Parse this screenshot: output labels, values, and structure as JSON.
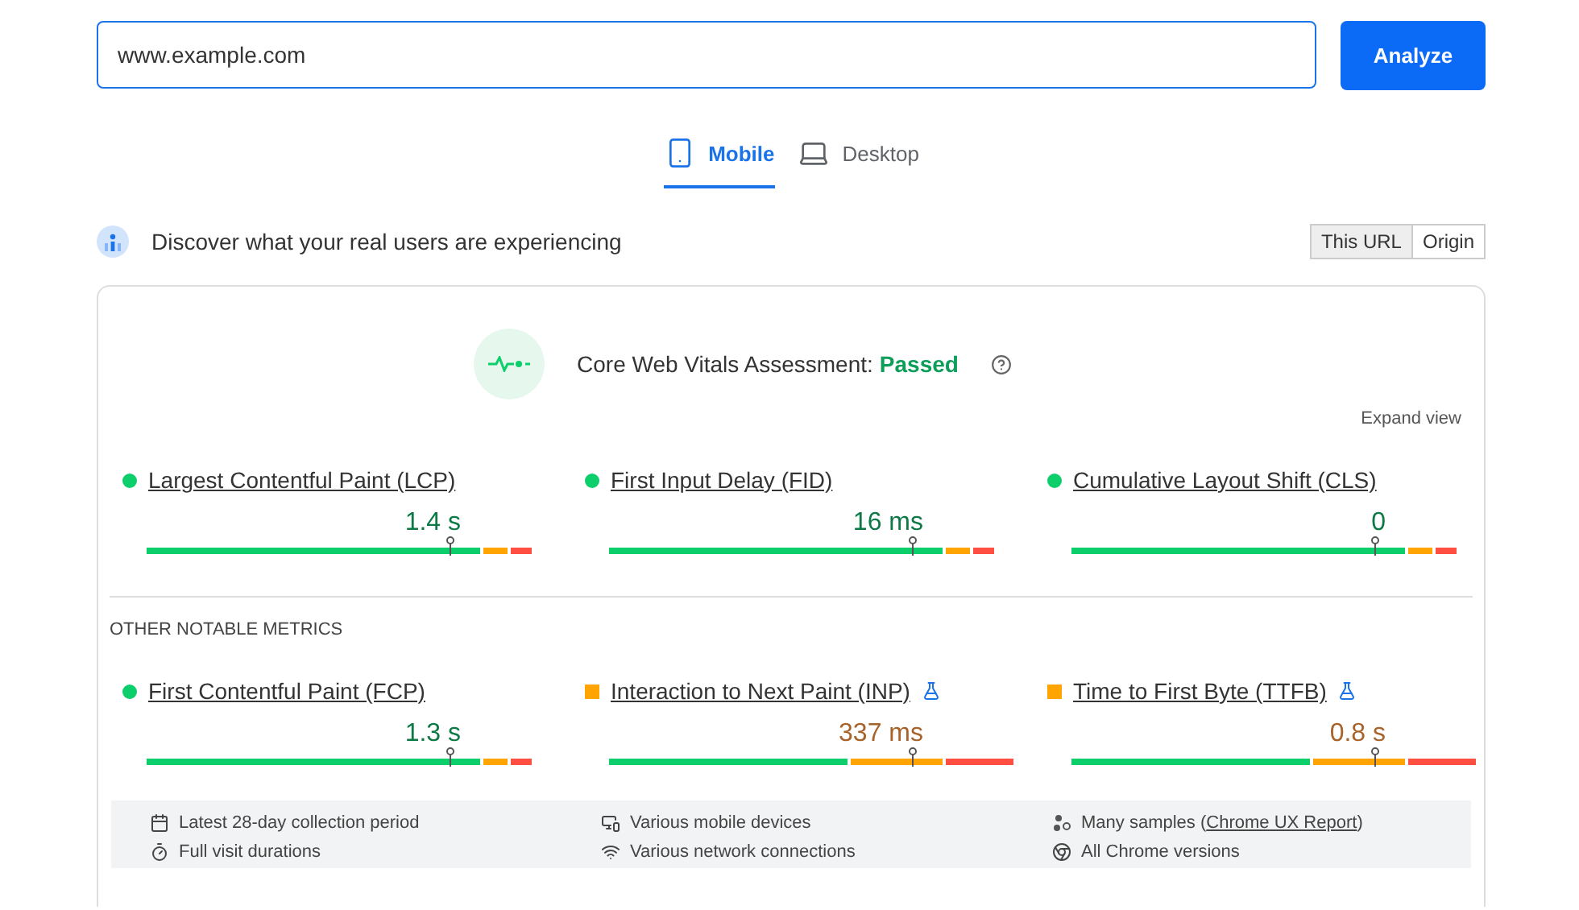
{
  "search": {
    "value": "www.example.com",
    "button": "Analyze"
  },
  "tabs": [
    {
      "label": "Mobile",
      "kind": "mobile",
      "selected": true
    },
    {
      "label": "Desktop",
      "kind": "desktop",
      "selected": false
    }
  ],
  "field_data": {
    "heading": "Discover what your real users are experiencing",
    "toggle": [
      {
        "label": "This URL",
        "selected": true
      },
      {
        "label": "Origin",
        "selected": false
      }
    ]
  },
  "assessment": {
    "label": "Core Web Vitals Assessment:",
    "result": "Passed",
    "expand": "Expand view"
  },
  "core_metrics": [
    {
      "name": "Largest Contentful Paint (LCP)",
      "value": "1.4 s",
      "kind": "good",
      "experimental": false,
      "level": 0.75
    },
    {
      "name": "First Input Delay (FID)",
      "value": "16 ms",
      "kind": "good",
      "experimental": false,
      "level": 0.75
    },
    {
      "name": "Cumulative Layout Shift (CLS)",
      "value": "0",
      "kind": "good",
      "experimental": false,
      "level": 0.75
    }
  ],
  "other_heading": "OTHER NOTABLE METRICS",
  "other_metrics": [
    {
      "name": "First Contentful Paint (FCP)",
      "value": "1.3 s",
      "kind": "good",
      "experimental": false,
      "level": 0.75
    },
    {
      "name": "Interaction to Next Paint (INP)",
      "value": "337 ms",
      "kind": "needs-improvement",
      "experimental": true,
      "level": 0.75
    },
    {
      "name": "Time to First Byte (TTFB)",
      "value": "0.8 s",
      "kind": "needs-improvement",
      "experimental": true,
      "level": 0.75
    }
  ],
  "details": [
    {
      "kind": "calendar",
      "text": "Latest 28-day collection period"
    },
    {
      "kind": "devices",
      "text": "Various mobile devices"
    },
    {
      "kind": "samples",
      "text": "Many samples (",
      "link": "Chrome UX Report",
      "after": ")"
    },
    {
      "kind": "timer",
      "text": "Full visit durations"
    },
    {
      "kind": "network",
      "text": "Various network connections"
    },
    {
      "kind": "chrome",
      "text": "All Chrome versions"
    }
  ]
}
